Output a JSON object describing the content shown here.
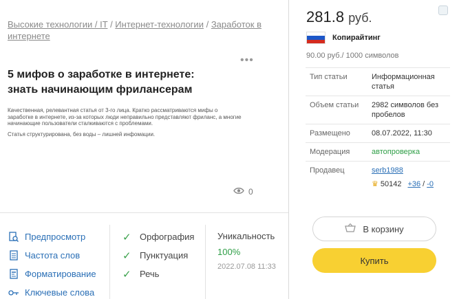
{
  "breadcrumb": {
    "items": [
      "Высокие технологии / IT",
      "Интернет-технологии",
      "Заработок в интернете"
    ]
  },
  "article": {
    "title": "5 мифов о заработке в интернете: знать начинающим фрилансерам",
    "desc1": "Качественная, релевантная статья от 3-го лица. Кратко рассматриваются мифы о заработке в интернете, из-за которых люди неправильно представляют фриланс, а многие начинающие пользователи сталкиваются с проблемами.",
    "desc2": "Статья структурирована, без воды – лишней инфомации.",
    "views": "0"
  },
  "tools": [
    {
      "label": "Предпросмотр",
      "icon": "preview-icon"
    },
    {
      "label": "Частота слов",
      "icon": "document-icon"
    },
    {
      "label": "Форматирование",
      "icon": "format-icon"
    },
    {
      "label": "Ключевые слова",
      "icon": "key-icon"
    }
  ],
  "checks": [
    "Орфография",
    "Пунктуация",
    "Речь"
  ],
  "uniqueness": {
    "label": "Уникальность",
    "value": "100%",
    "date": "2022.07.08 11:33"
  },
  "offer": {
    "price": "281.8",
    "currency": "руб.",
    "category": "Копирайтинг",
    "rate": "90.00 руб./ 1000 символов",
    "flag_colors": [
      "#ffffff",
      "#1c57c8",
      "#d52b1e"
    ]
  },
  "props": {
    "type_k": "Тип статьи",
    "type_v": "Информационная статья",
    "size_k": "Объем статьи",
    "size_v": "2982 символов без пробелов",
    "posted_k": "Размещено",
    "posted_v": "08.07.2022, 11:30",
    "moder_k": "Модерация",
    "moder_v": "автопроверка",
    "seller_k": "Продавец",
    "seller_name": "serb1988",
    "seller_rating": "50142",
    "seller_plus": "+36",
    "seller_slash": "/",
    "seller_minus": "-0"
  },
  "actions": {
    "cart": "В корзину",
    "buy": "Купить"
  },
  "colors": {
    "link": "#2a6fb6",
    "green": "#2e9e46",
    "buy": "#f8d032"
  }
}
